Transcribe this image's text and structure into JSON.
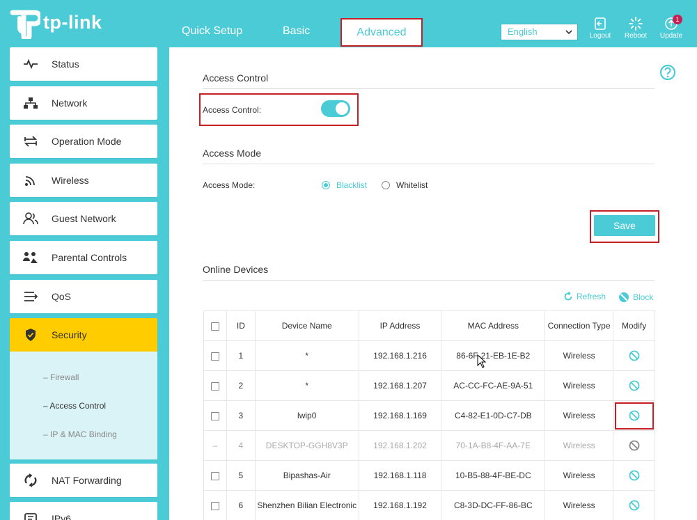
{
  "brand": {
    "name": "tp-link"
  },
  "nav": {
    "tabs": [
      {
        "label": "Quick Setup"
      },
      {
        "label": "Basic"
      },
      {
        "label": "Advanced"
      }
    ]
  },
  "header": {
    "language": "English",
    "logout_label": "Logout",
    "reboot_label": "Reboot",
    "update_label": "Update",
    "update_badge": "1"
  },
  "sidebar": {
    "items": [
      {
        "label": "Status",
        "icon": "pulse-icon"
      },
      {
        "label": "Network",
        "icon": "network-icon"
      },
      {
        "label": "Operation Mode",
        "icon": "swap-icon"
      },
      {
        "label": "Wireless",
        "icon": "wifi-icon"
      },
      {
        "label": "Guest Network",
        "icon": "guest-icon"
      },
      {
        "label": "Parental Controls",
        "icon": "family-icon"
      },
      {
        "label": "QoS",
        "icon": "qos-icon"
      },
      {
        "label": "Security",
        "icon": "shield-icon"
      },
      {
        "label": "NAT Forwarding",
        "icon": "nat-icon"
      },
      {
        "label": "IPv6",
        "icon": "ipv6-icon"
      }
    ],
    "security_sub": [
      {
        "label": "Firewall"
      },
      {
        "label": "Access Control"
      },
      {
        "label": "IP & MAC Binding"
      }
    ]
  },
  "access_control": {
    "title": "Access Control",
    "toggle_label": "Access Control:",
    "enabled": true
  },
  "access_mode": {
    "title": "Access Mode",
    "label": "Access Mode:",
    "options": [
      "Blacklist",
      "Whitelist"
    ],
    "selected": "Blacklist"
  },
  "save_label": "Save",
  "online_devices": {
    "title": "Online Devices",
    "refresh_label": "Refresh",
    "block_label": "Block",
    "columns": [
      "ID",
      "Device Name",
      "IP Address",
      "MAC Address",
      "Connection Type",
      "Modify"
    ],
    "rows": [
      {
        "id": "1",
        "name": "*",
        "ip": "192.168.1.216",
        "mac": "86-6F-21-EB-1E-B2",
        "type": "Wireless"
      },
      {
        "id": "2",
        "name": "*",
        "ip": "192.168.1.207",
        "mac": "AC-CC-FC-AE-9A-51",
        "type": "Wireless"
      },
      {
        "id": "3",
        "name": "lwip0",
        "ip": "192.168.1.169",
        "mac": "C4-82-E1-0D-C7-DB",
        "type": "Wireless"
      },
      {
        "id": "4",
        "name": "DESKTOP-GGH8V3P",
        "ip": "192.168.1.202",
        "mac": "70-1A-B8-4F-AA-7E",
        "type": "Wireless"
      },
      {
        "id": "5",
        "name": "Bipashas-Air",
        "ip": "192.168.1.118",
        "mac": "10-B5-88-4F-BE-DC",
        "type": "Wireless"
      },
      {
        "id": "6",
        "name": "Shenzhen Bilian Electronic",
        "ip": "192.168.1.192",
        "mac": "C8-3D-DC-FF-86-BC",
        "type": "Wireless"
      }
    ]
  },
  "colors": {
    "accent": "#4acbd6",
    "active_menu": "#ffcc00",
    "highlight": "#c42026"
  }
}
